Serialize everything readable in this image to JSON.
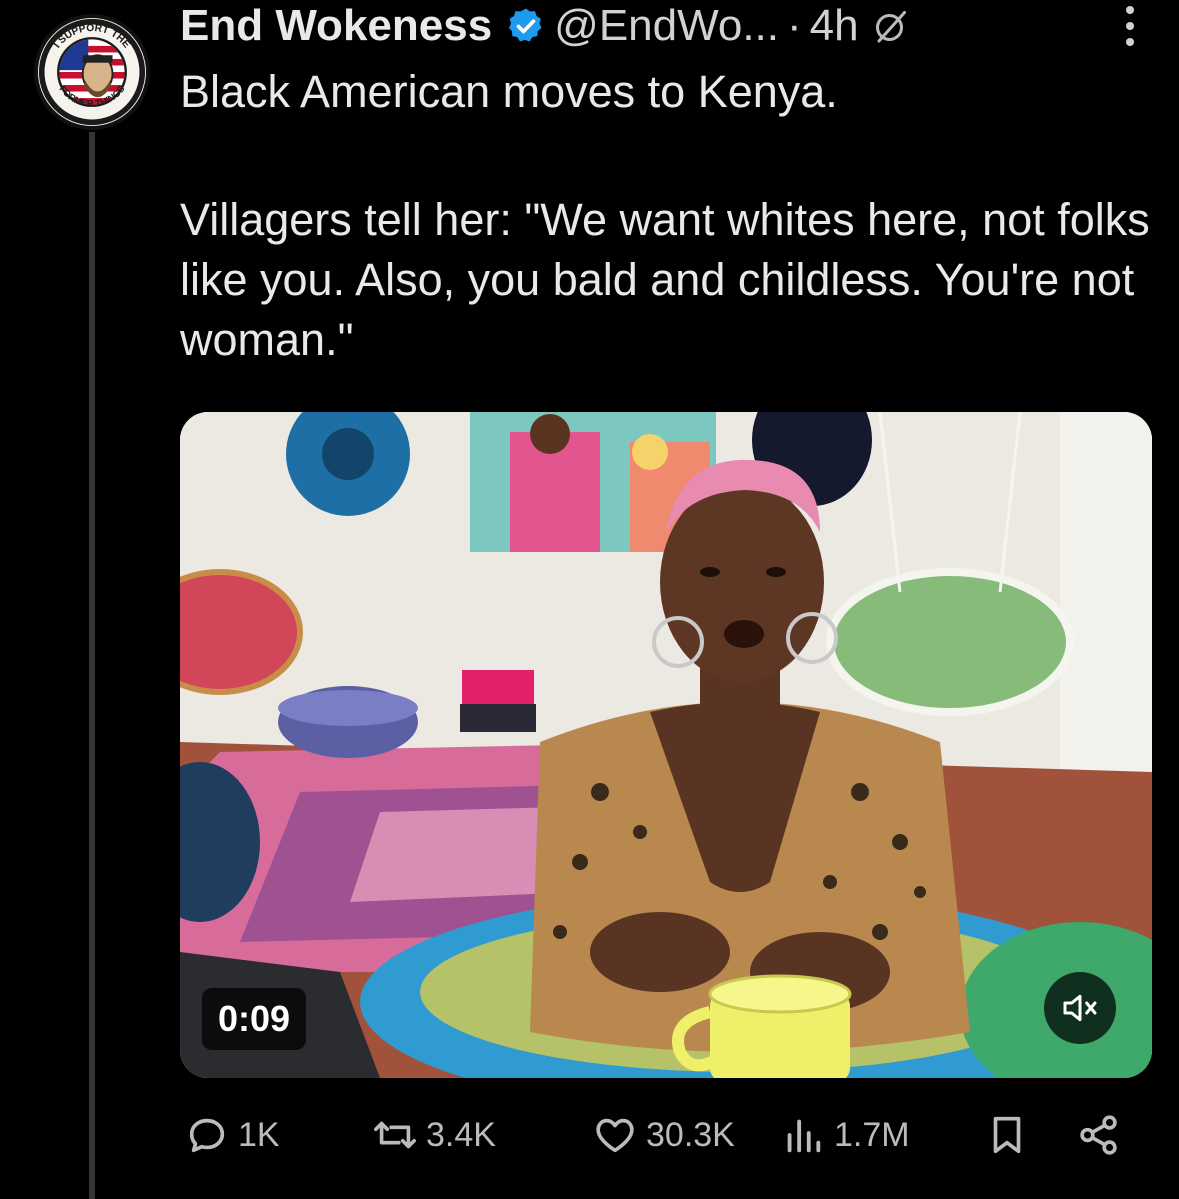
{
  "post": {
    "author_name": "End Wokeness",
    "handle": "@EndWo...",
    "separator": "·",
    "time_ago": "4h",
    "verified": true,
    "avatar_text_top": "I SUPPORT THE",
    "avatar_text_bottom": "FORMER THINGS",
    "text_line_1": "Black American moves to Kenya.",
    "text_paragraph_2": "Villagers tell her: \"We want whites here, not folks like you. Also, you bald and childless. You're not woman.\""
  },
  "media": {
    "type": "video",
    "duration_label": "0:09",
    "muted": true
  },
  "actions": {
    "replies": "1K",
    "reposts": "3.4K",
    "likes": "30.3K",
    "views": "1.7M"
  },
  "colors": {
    "background": "#000000",
    "text": "#e7e9ea",
    "muted_text": "#b9bcbf",
    "verified_blue": "#1d9bf0",
    "thread_line": "#333639"
  },
  "icons": [
    "verified-badge-icon",
    "grok-icon",
    "more-icon",
    "mute-icon",
    "reply-icon",
    "repost-icon",
    "like-icon",
    "views-icon",
    "bookmark-icon",
    "share-icon"
  ]
}
